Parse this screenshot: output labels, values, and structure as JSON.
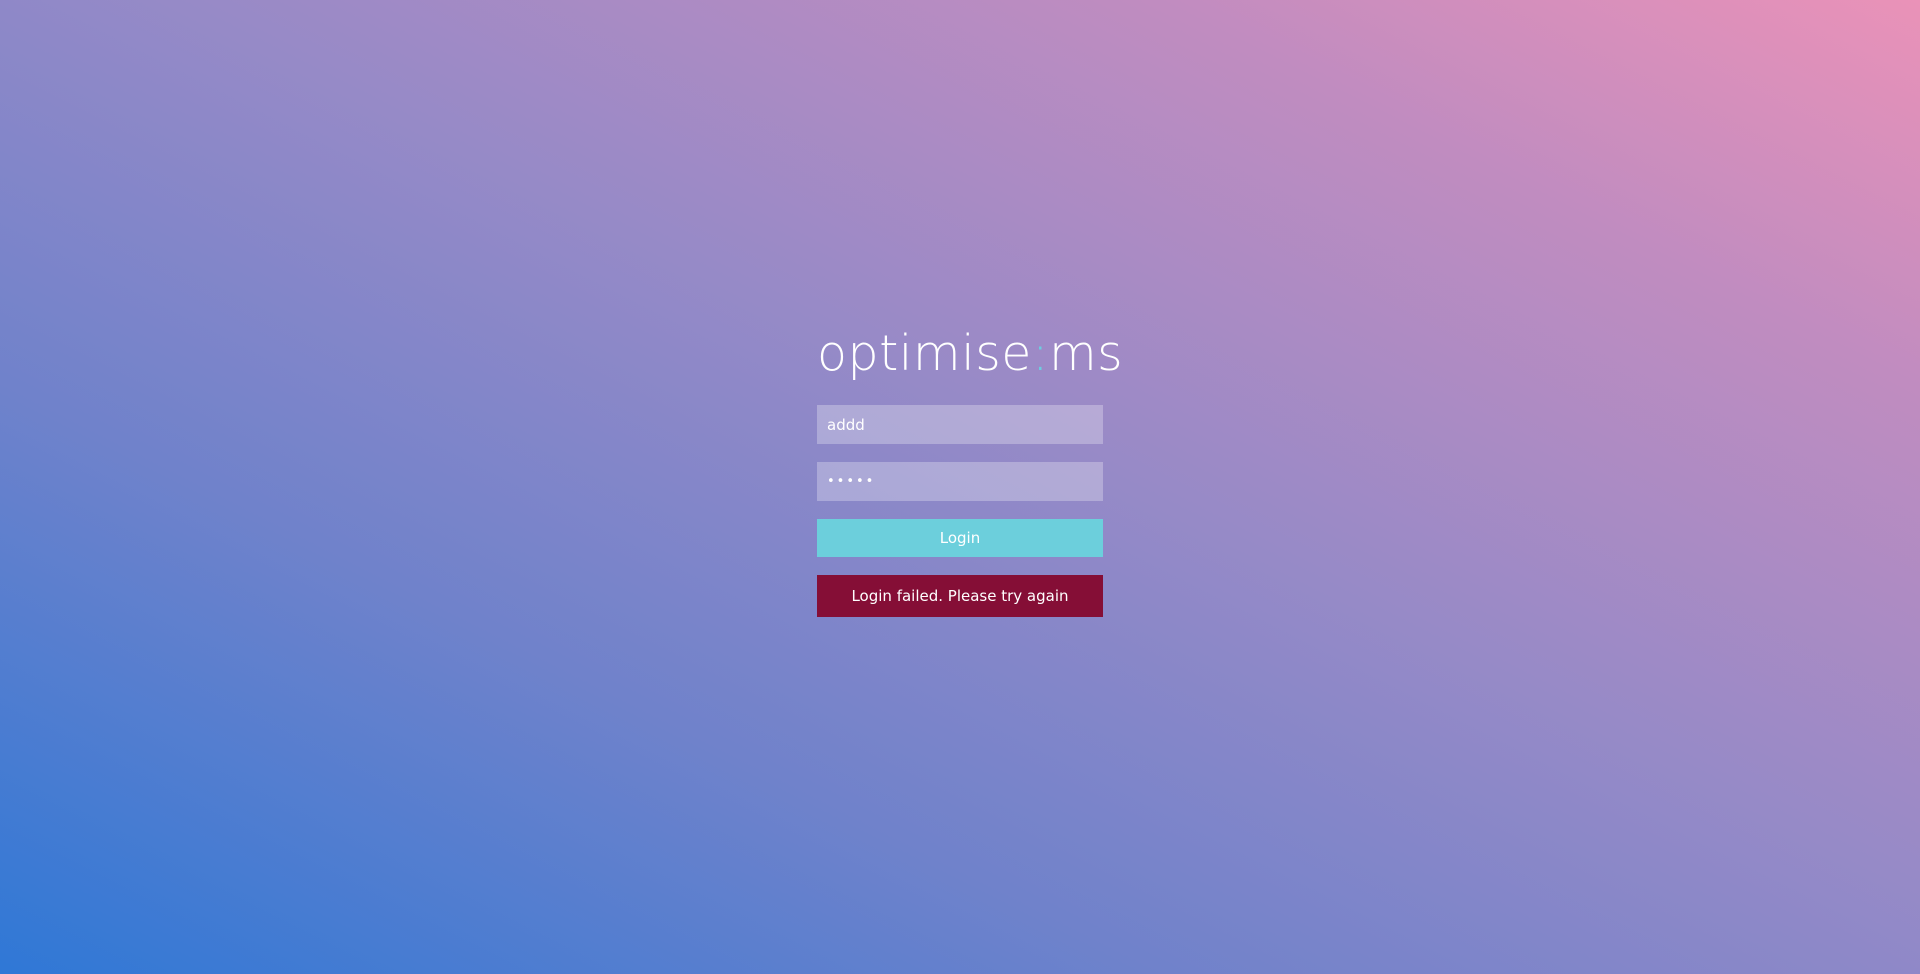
{
  "logo": {
    "text_before": "optimise",
    "separator": ":",
    "text_after": "ms",
    "accent_color": "#6ccfe0"
  },
  "form": {
    "username_value": "addd",
    "password_value": "•••••",
    "login_label": "Login",
    "login_button_color": "#6ccfdc"
  },
  "error": {
    "message": "Login failed. Please try again",
    "color": "#850e36"
  }
}
